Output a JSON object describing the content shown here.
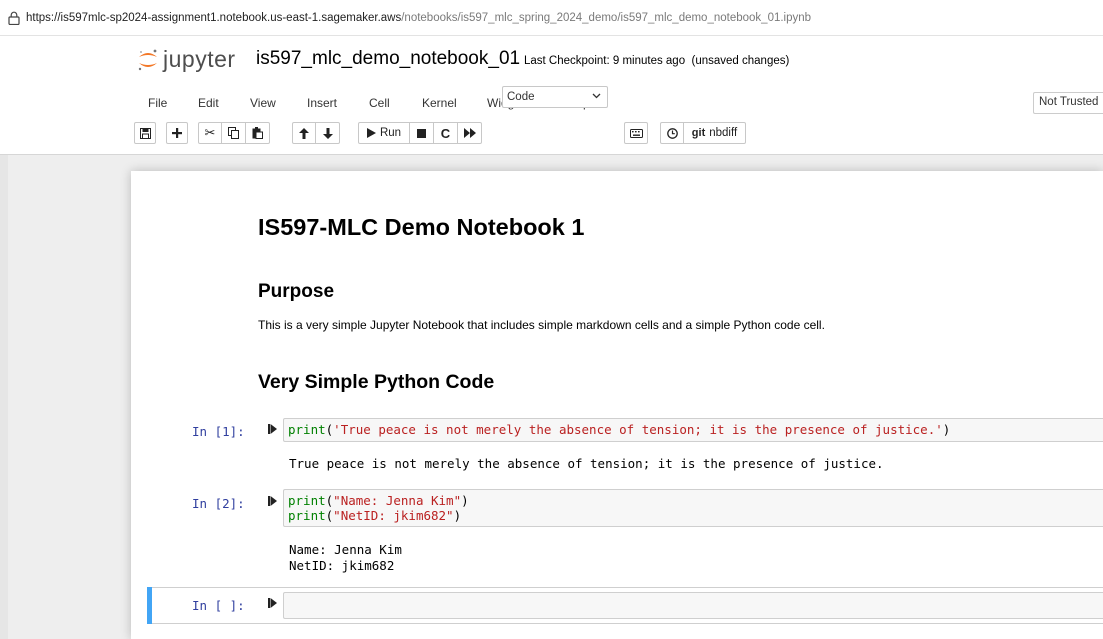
{
  "browser": {
    "url_host": "https://is597mlc-sp2024-assignment1.notebook.us-east-1.sagemaker.aws",
    "url_path": "/notebooks/is597_mlc_spring_2024_demo/is597_mlc_demo_notebook_01.ipynb"
  },
  "header": {
    "logo_text": "jupyter",
    "notebook_name": "is597_mlc_demo_notebook_01",
    "checkpoint": "Last Checkpoint: 9 minutes ago",
    "unsaved": "(unsaved changes)",
    "trusted": "Not Trusted"
  },
  "menu": [
    "File",
    "Edit",
    "View",
    "Insert",
    "Cell",
    "Kernel",
    "Widgets",
    "Help"
  ],
  "toolbar": {
    "run_label": "Run",
    "cell_type": "Code",
    "nbdiff_label": "nbdiff",
    "git_label": "git"
  },
  "notebook": {
    "title": "IS597-MLC Demo Notebook 1",
    "purpose_heading": "Purpose",
    "purpose_text": "This is a very simple Jupyter Notebook that includes simple markdown cells and a simple Python code cell.",
    "code_heading": "Very Simple Python Code",
    "cells": [
      {
        "prompt": "In [1]:",
        "lines": [
          {
            "fn": "print",
            "arg": "'True peace is not merely the absence of tension; it is the presence of justice.'"
          }
        ],
        "output": "True peace is not merely the absence of tension; it is the presence of justice."
      },
      {
        "prompt": "In [2]:",
        "lines": [
          {
            "fn": "print",
            "arg": "\"Name: Jenna Kim\""
          },
          {
            "fn": "print",
            "arg": "\"NetID: jkim682\""
          }
        ],
        "output_lines": [
          "Name: Jenna Kim",
          "NetID: jkim682"
        ]
      },
      {
        "prompt": "In [ ]:"
      }
    ]
  },
  "colors": {
    "prompt": "#303f9f",
    "keyword": "#008000",
    "string": "#ba2121",
    "selected_cell": "#42a5f5"
  }
}
